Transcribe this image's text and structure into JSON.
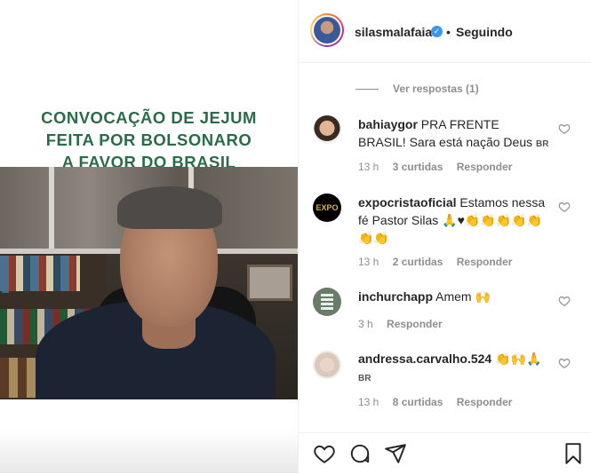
{
  "media": {
    "title_lines": [
      "CONVOCAÇÃO DE JEJUM",
      "FEITA POR BOLSONARO",
      "A FAVOR DO BRASIL"
    ]
  },
  "header": {
    "username": "silasmalafaia",
    "dot": "•",
    "follow_status": "Seguindo"
  },
  "comments": {
    "view_replies": "Ver respostas (1)",
    "items": [
      {
        "username": "bahiaygor",
        "text": "PRA FRENTE BRASIL! Sara está nação Deus",
        "flag": "BR",
        "time": "13 h",
        "likes": "3 curtidas",
        "reply": "Responder"
      },
      {
        "username": "expocristaoficial",
        "text": "Estamos nessa fé Pastor Silas 🙏♥👏👏👏👏👏👏👏",
        "flag": "",
        "time": "13 h",
        "likes": "2 curtidas",
        "reply": "Responder"
      },
      {
        "username": "inchurchapp",
        "text": "Amem 🙌",
        "flag": "",
        "time": "3 h",
        "likes": "",
        "reply": "Responder"
      },
      {
        "username": "andressa.carvalho.524",
        "text": "👏🙌🙏",
        "flag": "BR",
        "time": "13 h",
        "likes": "8 curtidas",
        "reply": "Responder"
      }
    ]
  },
  "colors": {
    "title_green": "#2a6b4a",
    "verified_blue": "#3897f0",
    "muted": "#8e8e8e"
  },
  "icons": [
    "verified-badge-icon",
    "heart-icon",
    "comment-icon",
    "share-icon",
    "bookmark-icon"
  ]
}
